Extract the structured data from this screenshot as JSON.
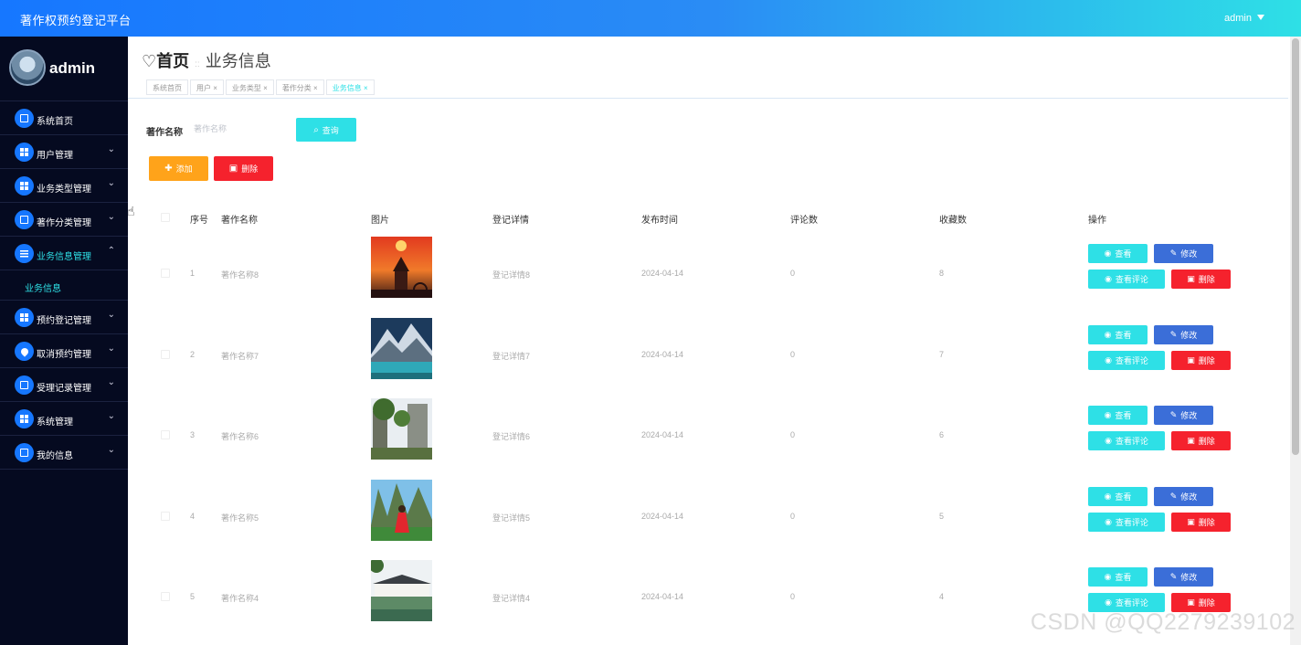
{
  "header": {
    "title": "著作权预约登记平台",
    "user": "admin"
  },
  "sidebar": {
    "username": "admin",
    "items": [
      {
        "label": "系统首页",
        "icon": "home-icon"
      },
      {
        "label": "用户管理",
        "icon": "grid-icon"
      },
      {
        "label": "业务类型管理",
        "icon": "grid-icon"
      },
      {
        "label": "著作分类管理",
        "icon": "clipboard-icon"
      },
      {
        "label": "业务信息管理",
        "icon": "list-icon"
      },
      {
        "label": "预约登记管理",
        "icon": "grid-icon"
      },
      {
        "label": "取消预约管理",
        "icon": "location-icon"
      },
      {
        "label": "受理记录管理",
        "icon": "clipboard-icon"
      },
      {
        "label": "系统管理",
        "icon": "grid-icon"
      },
      {
        "label": "我的信息",
        "icon": "card-icon"
      }
    ],
    "subitem": "业务信息"
  },
  "breadcrumb": {
    "home": "首页",
    "current": "业务信息"
  },
  "tags": [
    "系统首页",
    "用户",
    "业务类型",
    "著作分类",
    "业务信息"
  ],
  "search": {
    "label": "著作名称",
    "placeholder": "著作名称",
    "button": "查询"
  },
  "actions": {
    "add": "添加",
    "delete": "删除"
  },
  "table": {
    "headers": {
      "index": "序号",
      "name": "著作名称",
      "image": "图片",
      "detail": "登记详情",
      "time": "发布时间",
      "comments": "评论数",
      "favorites": "收藏数",
      "ops": "操作"
    },
    "buttons": {
      "view": "查看",
      "edit": "修改",
      "comments": "查看评论",
      "delete": "删除"
    },
    "rows": [
      {
        "index": "1",
        "name": "著作名称8",
        "detail": "登记详情8",
        "time": "2024-04-14",
        "comments": "0",
        "favorites": "8"
      },
      {
        "index": "2",
        "name": "著作名称7",
        "detail": "登记详情7",
        "time": "2024-04-14",
        "comments": "0",
        "favorites": "7"
      },
      {
        "index": "3",
        "name": "著作名称6",
        "detail": "登记详情6",
        "time": "2024-04-14",
        "comments": "0",
        "favorites": "6"
      },
      {
        "index": "4",
        "name": "著作名称5",
        "detail": "登记详情5",
        "time": "2024-04-14",
        "comments": "0",
        "favorites": "5"
      },
      {
        "index": "5",
        "name": "著作名称4",
        "detail": "登记详情4",
        "time": "2024-04-14",
        "comments": "0",
        "favorites": "4"
      }
    ]
  },
  "watermark": "CSDN @QQ2279239102",
  "colors": {
    "accent": "#2ee0e6",
    "primary": "#1677ff",
    "danger": "#f5222d",
    "warning": "#ffa31a",
    "edit": "#3b6ed8",
    "sidebar": "#050a20"
  }
}
